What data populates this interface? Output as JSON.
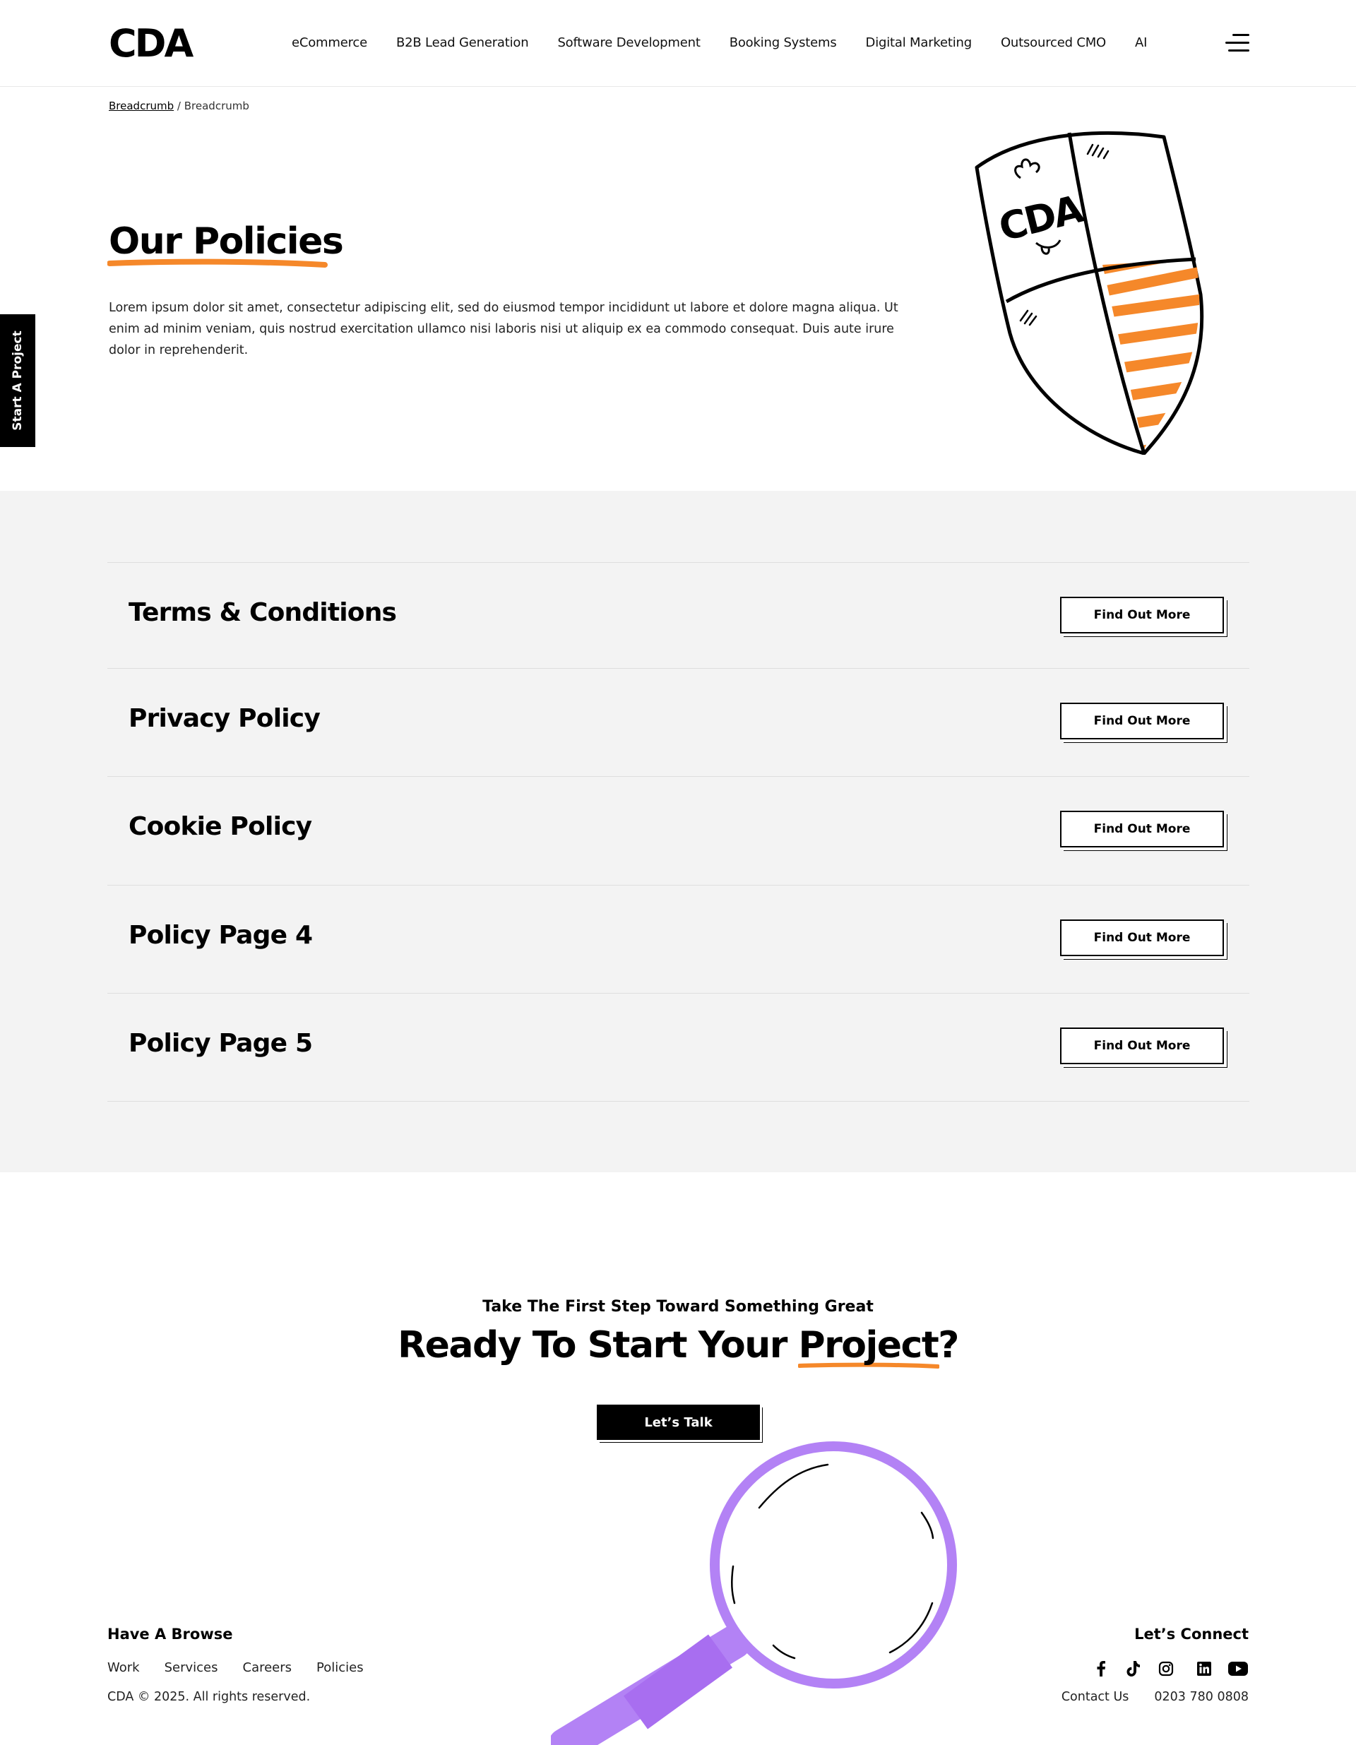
{
  "header": {
    "logo_text": "CDA",
    "nav": [
      "eCommerce",
      "B2B Lead Generation",
      "Software Development",
      "Booking Systems",
      "Digital Marketing",
      "Outsourced CMO",
      "AI"
    ]
  },
  "breadcrumb": {
    "link": "Breadcrumb",
    "separator": "/",
    "current": "Breadcrumb"
  },
  "side_tab": {
    "label": "Start A Project"
  },
  "hero": {
    "title": "Our Policies",
    "text": "Lorem ipsum dolor sit amet, consectetur adipiscing elit, sed do eiusmod tempor incididunt ut labore et dolore magna aliqua. Ut enim ad minim veniam, quis nostrud exercitation ullamco nisi laboris nisi ut aliquip ex ea commodo consequat. Duis aute irure dolor in reprehenderit.",
    "shield_text": "CDA"
  },
  "policies": {
    "button_label": "Find Out More",
    "items": [
      "Terms & Conditions",
      "Privacy Policy",
      "Cookie Policy",
      "Policy Page 4",
      "Policy Page 5"
    ]
  },
  "cta": {
    "kicker": "Take The First Step Toward Something Great",
    "title_prefix": "Ready To Start Your ",
    "title_highlight": "Project?",
    "button_label": "Let’s Talk"
  },
  "footer": {
    "browse_heading": "Have A Browse",
    "links": [
      "Work",
      "Services",
      "Careers",
      "Policies"
    ],
    "copyright": "CDA © 2025. All rights reserved.",
    "connect_heading": "Let’s Connect",
    "contact_label": "Contact Us",
    "phone": "0203 780 0808",
    "socials": [
      "facebook-icon",
      "tiktok-icon",
      "instagram-icon",
      "linkedin-icon",
      "youtube-icon"
    ]
  },
  "colors": {
    "accent_orange": "#f5882a",
    "magnifier_purple": "#b382f5",
    "section_gray": "#f3f3f3"
  }
}
